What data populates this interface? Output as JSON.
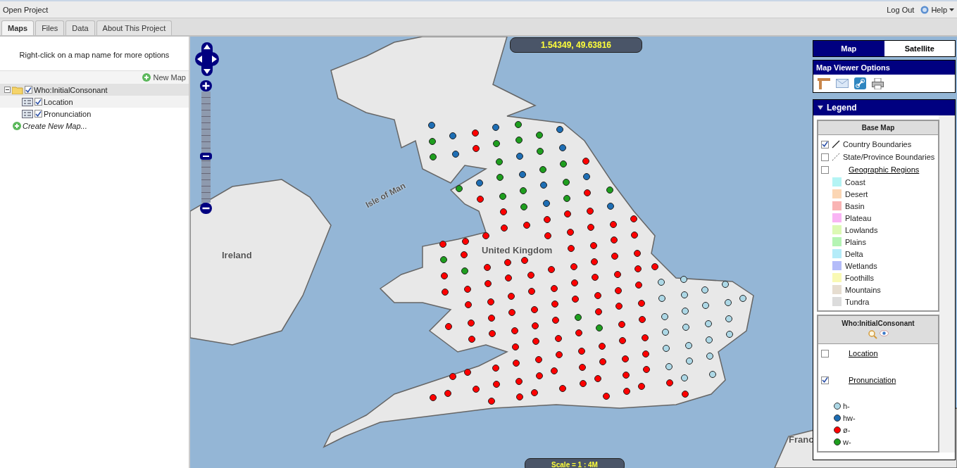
{
  "top_bar": {
    "title": "Open Project",
    "logout": "Log Out",
    "help": "Help"
  },
  "tabs": [
    {
      "label": "Maps",
      "selected": true
    },
    {
      "label": "Files",
      "selected": false
    },
    {
      "label": "Data",
      "selected": false
    },
    {
      "label": "About This Project",
      "selected": false
    }
  ],
  "left_panel": {
    "hint": "Right-click on a map name for more options",
    "new_map": "New Map",
    "tree": [
      {
        "label": "Who:InitialConsonant",
        "checked": true,
        "expanded": true,
        "selected": true,
        "children": [
          {
            "label": "Location",
            "checked": true,
            "selected": false
          },
          {
            "label": "Pronunciation",
            "checked": true,
            "selected": false
          }
        ]
      }
    ],
    "create": "Create New Map..."
  },
  "map": {
    "coordinates": "1.54349, 49.63816",
    "scale": "Scale = 1 : 4M",
    "zoom": {
      "level": 0.42
    },
    "labels": [
      {
        "text": "Ireland",
        "kind": "country"
      },
      {
        "text": "Isle of Man",
        "kind": "island"
      },
      {
        "text": "United Kingdom",
        "kind": "country"
      },
      {
        "text": "Franc",
        "kind": "country"
      }
    ]
  },
  "view_tabs": [
    {
      "label": "Map",
      "selected": true
    },
    {
      "label": "Satellite",
      "selected": false
    }
  ],
  "options": {
    "title": "Map Viewer Options"
  },
  "legend": {
    "title": "Legend",
    "expanded": true,
    "base_map": {
      "title": "Base Map",
      "layers": [
        {
          "label": "Country Boundaries",
          "checked": true,
          "kind": "line"
        },
        {
          "label": "State/Province Boundaries",
          "checked": false,
          "kind": "dashed"
        },
        {
          "label": "Geographic Regions",
          "checked": false,
          "kind": "link"
        }
      ],
      "regions": [
        {
          "label": "Coast",
          "color": "#b4f4f4"
        },
        {
          "label": "Desert",
          "color": "#fbd6b4"
        },
        {
          "label": "Basin",
          "color": "#f9b4b4"
        },
        {
          "label": "Plateau",
          "color": "#f9b4f4"
        },
        {
          "label": "Lowlands",
          "color": "#dcf9b4"
        },
        {
          "label": "Plains",
          "color": "#b4f4b4"
        },
        {
          "label": "Delta",
          "color": "#b4ecf9"
        },
        {
          "label": "Wetlands",
          "color": "#b4bcf9"
        },
        {
          "label": "Foothills",
          "color": "#f9f9b4"
        },
        {
          "label": "Mountains",
          "color": "#e6ddd0"
        },
        {
          "label": "Tundra",
          "color": "#dcdcdc"
        }
      ]
    },
    "map_layer": {
      "title": "Who:InitialConsonant",
      "layers": [
        {
          "label": "Location",
          "checked": false
        },
        {
          "label": "Pronunciation",
          "checked": true
        }
      ],
      "categories": [
        {
          "label": "h-",
          "color": "#add8e6"
        },
        {
          "label": "hw-",
          "color": "#1e6eb4"
        },
        {
          "label": "ø-",
          "color": "#ff0000"
        },
        {
          "label": "w-",
          "color": "#1e9e1e"
        }
      ]
    }
  }
}
